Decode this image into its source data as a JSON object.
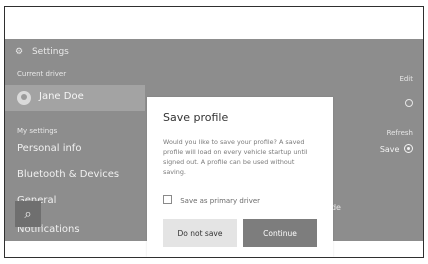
{
  "header": {
    "icon": "gear-icon",
    "title": "Settings"
  },
  "sidebar": {
    "current_driver_label": "Current driver",
    "current_driver_name": "Jane Doe",
    "my_settings_label": "My settings",
    "items": [
      {
        "label": "Personal info"
      },
      {
        "label": "Bluetooth & Devices"
      },
      {
        "label": "General"
      },
      {
        "label": "Notifications"
      }
    ]
  },
  "right_panel": {
    "edit_label": "Edit",
    "refresh_label": "Refresh",
    "save_label": "Save",
    "mode_fragment": "node"
  },
  "search_fab": {
    "icon": "search-icon"
  },
  "modal": {
    "title": "Save profile",
    "body": "Would you like to save your profile? A saved profile will load on every vehicle startup until signed out. A profile can be used without saving.",
    "checkbox_label": "Save as primary driver",
    "buttons": {
      "secondary": "Do not save",
      "primary": "Continue"
    }
  },
  "colors": {
    "dim_background": "#8d8d8d",
    "primary_button": "#7d7d7d",
    "secondary_button": "#e4e4e4"
  }
}
